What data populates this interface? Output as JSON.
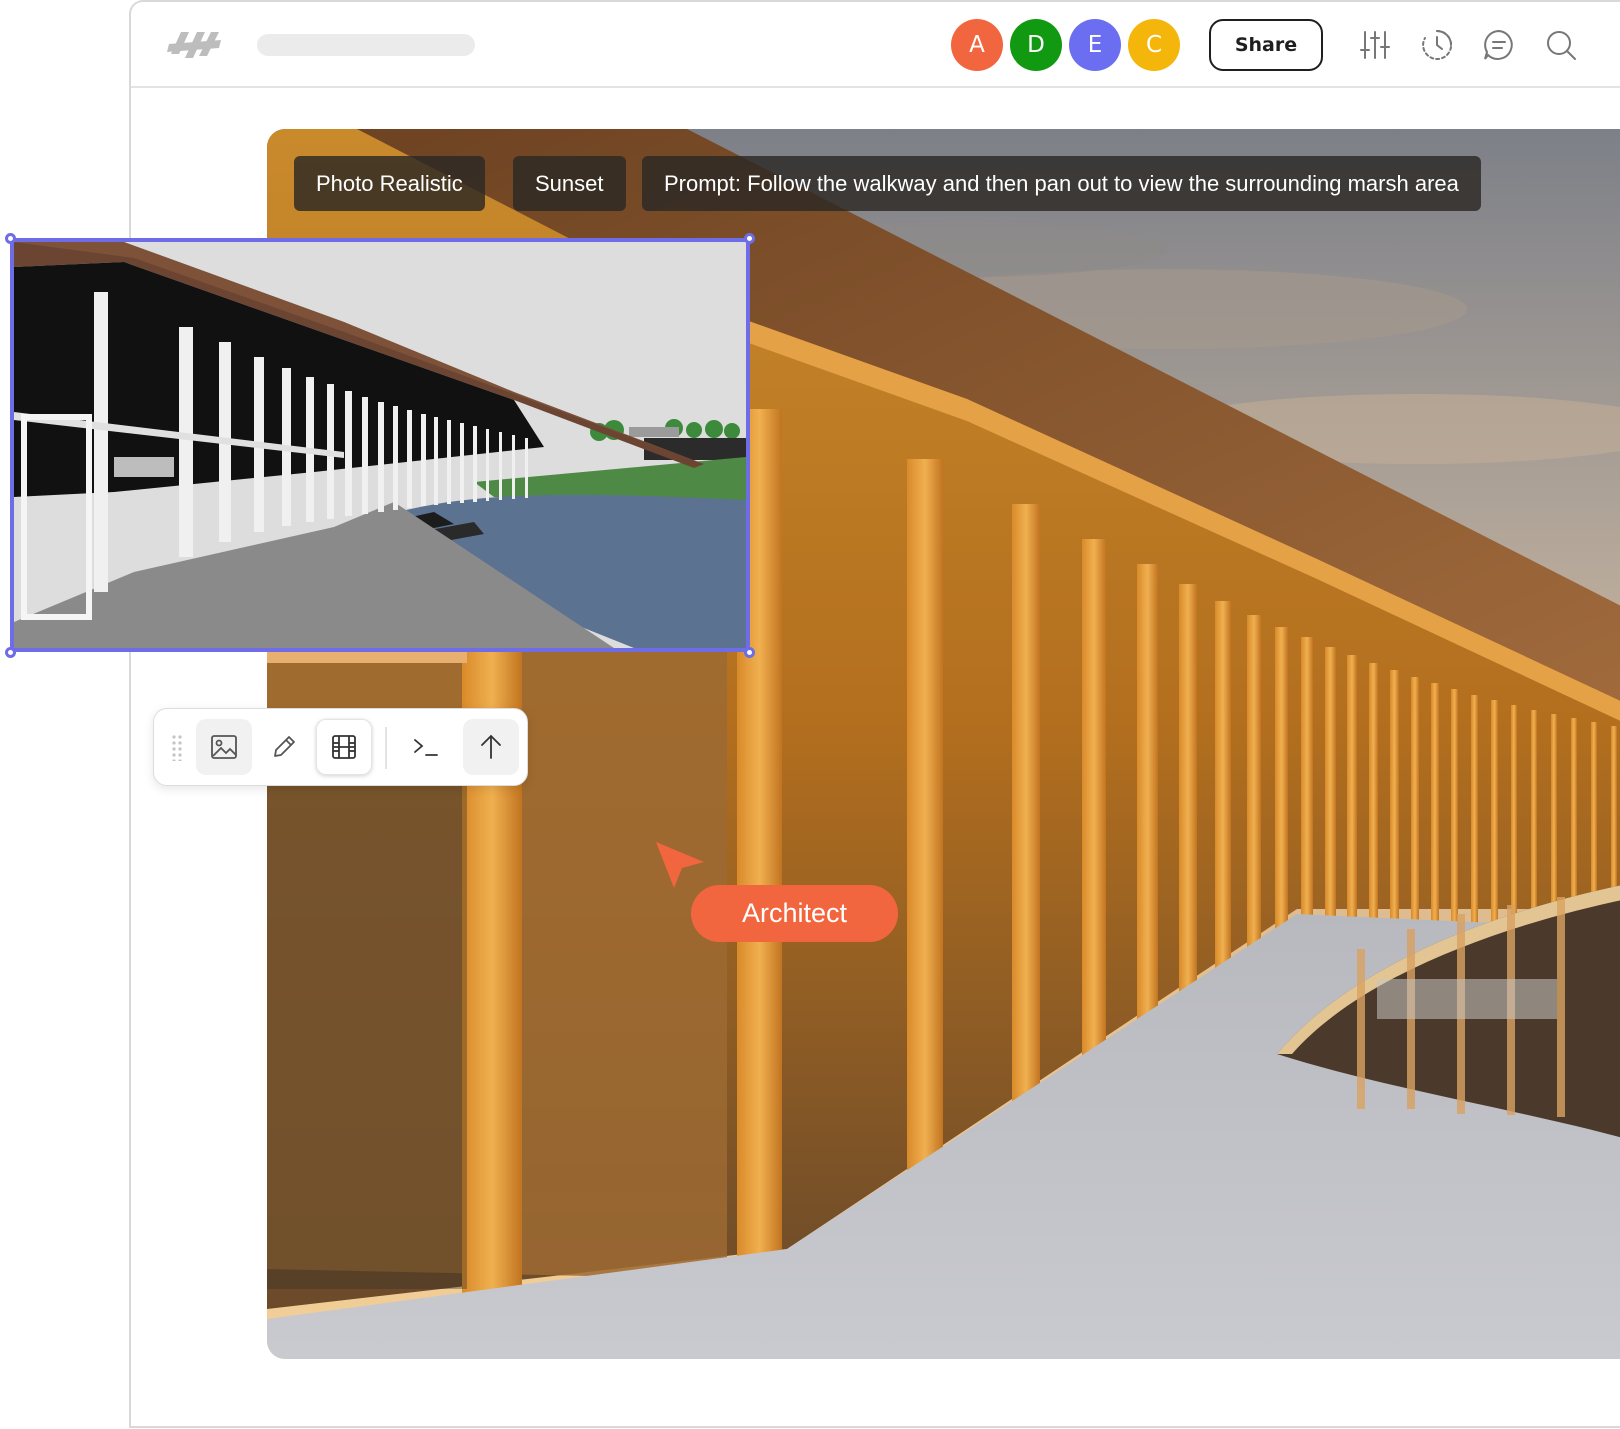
{
  "topbar": {
    "logo_icon": "brand-logo-icon",
    "collaborators": [
      {
        "initial": "A",
        "color": "#f2663f"
      },
      {
        "initial": "D",
        "color": "#119a11"
      },
      {
        "initial": "E",
        "color": "#6b6ef0"
      },
      {
        "initial": "C",
        "color": "#f5b60c"
      }
    ],
    "share_label": "Share",
    "icons": [
      "sliders-icon",
      "history-icon",
      "comment-icon",
      "search-icon"
    ]
  },
  "render": {
    "tags": [
      "Photo Realistic",
      "Sunset"
    ],
    "prompt": "Prompt: Follow the walkway and then pan out to view the surrounding marsh area"
  },
  "toolbar": {
    "tools": [
      "drag-handle-icon",
      "image-icon",
      "pencil-icon",
      "film-icon",
      "terminal-icon",
      "arrow-up-icon"
    ],
    "active_tool": "film-icon"
  },
  "cursor": {
    "label": "Architect",
    "color": "#f2663f"
  }
}
